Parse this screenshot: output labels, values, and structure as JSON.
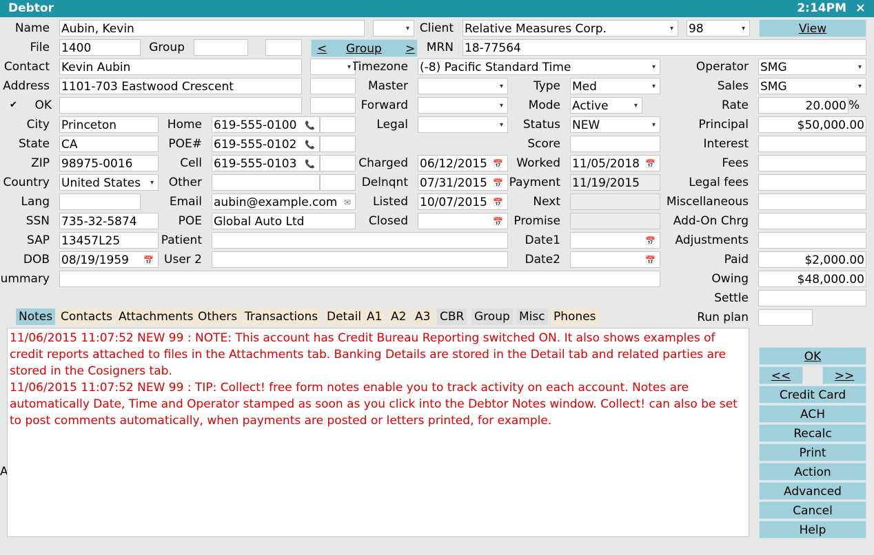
{
  "title": "Debtor",
  "clock": "2:14PM",
  "close": "×",
  "labels": {
    "name": "Name",
    "file": "File",
    "group": "Group",
    "contact": "Contact",
    "address": "Address",
    "ok": "OK",
    "city": "City",
    "state": "State",
    "zip": "ZIP",
    "country": "Country",
    "lang": "Lang",
    "ssn": "SSN",
    "sap": "SAP",
    "dob": "DOB",
    "summary": "Summary",
    "home": "Home",
    "poe_num": "POE#",
    "cell": "Cell",
    "other": "Other",
    "email": "Email",
    "poe": "POE",
    "patient": "Patient",
    "user2": "User 2",
    "client": "Client",
    "mrn": "MRN",
    "timezone": "Timezone",
    "master": "Master",
    "forward": "Forward",
    "legal": "Legal",
    "charged": "Charged",
    "delnqnt": "Delnqnt",
    "listed": "Listed",
    "closed": "Closed",
    "type": "Type",
    "mode": "Mode",
    "status": "Status",
    "score": "Score",
    "worked": "Worked",
    "payment": "Payment",
    "next": "Next",
    "promise": "Promise",
    "date1": "Date1",
    "date2": "Date2",
    "operator": "Operator",
    "sales": "Sales",
    "rate": "Rate",
    "principal": "Principal",
    "interest": "Interest",
    "fees": "Fees",
    "legal_fees": "Legal fees",
    "misc": "Miscellaneous",
    "addon": "Add-On Chrg",
    "adjustments": "Adjustments",
    "paid": "Paid",
    "owing": "Owing",
    "settle": "Settle",
    "run_plan": "Run plan",
    "stray_a": "A"
  },
  "values": {
    "name": "Aubin, Kevin",
    "file": "1400",
    "contact": "Kevin Aubin",
    "address": "1101-703 Eastwood Crescent",
    "ok_checkbox": "✔",
    "city": "Princeton",
    "state": "CA",
    "zip": "98975-0016",
    "country": "United States",
    "ssn": "735-32-5874",
    "sap": "13457L25",
    "dob": "08/19/1959",
    "home": "619-555-0100",
    "poe_num": "619-555-0102",
    "cell": "619-555-0103",
    "email": "aubin@example.com",
    "poe": "Global Auto Ltd",
    "client": "Relative Measures Corp.",
    "client_num": "98",
    "mrn": "18-77564",
    "timezone": "(-8) Pacific Standard Time",
    "charged": "06/12/2015",
    "delnqnt": "07/31/2015",
    "listed": "10/07/2015",
    "type": "Med",
    "mode": "Active",
    "status": "NEW",
    "worked": "11/05/2018",
    "payment": "11/19/2015",
    "operator": "SMG",
    "sales": "SMG",
    "rate": "20.000",
    "rate_unit": "%",
    "principal": "$50,000.00",
    "paid": "$2,000.00",
    "owing": "$48,000.00"
  },
  "buttons": {
    "view": "View",
    "group_prev": "<",
    "group": "Group",
    "group_next": ">",
    "ok": "OK",
    "prev": "<<",
    "next": ">>",
    "credit_card": "Credit Card",
    "ach": "ACH",
    "recalc": "Recalc",
    "print": "Print",
    "action": "Action",
    "advanced": "Advanced",
    "cancel": "Cancel",
    "help": "Help"
  },
  "tabs": [
    "Notes",
    "Contacts",
    "Attachments",
    "Others",
    "Transactions",
    "Detail",
    "A1",
    "A2",
    "A3",
    "CBR",
    "Group",
    "Misc",
    "Phones"
  ],
  "notes": [
    "11/06/2015 11:07:52 NEW 99 : NOTE: This account has Credit Bureau Reporting switched ON. It also shows examples of credit reports attached to files in the Attachments tab. Banking Details are stored in the Detail tab and related parties are stored in the Cosigners tab.",
    "11/06/2015 11:07:52 NEW 99 : TIP: Collect! free form notes enable you to track activity on each account. Notes are automatically Date, Time and Operator stamped as soon as you click into the Debtor Notes window. Collect! can also be set to post comments automatically, when payments are posted or letters printed, for example."
  ],
  "icons": {
    "dropdown": "▾",
    "phone": "📞",
    "email": "✉",
    "calendar": "📅"
  },
  "colors": {
    "titlebar": "#1e93a5",
    "button": "#9fd0db",
    "notes_text": "#e00000",
    "tab": "#f3e9d3"
  }
}
